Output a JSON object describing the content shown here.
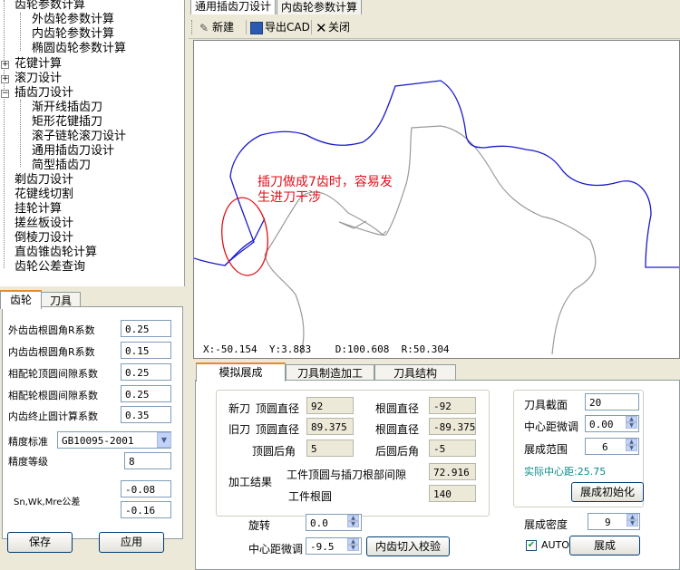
{
  "tree": {
    "items": [
      "齿轮参数计算",
      "外齿轮参数计算",
      "内齿轮参数计算",
      "椭圆齿轮参数计算",
      "花键计算",
      "滚刀设计",
      "插齿刀设计",
      "渐开线插齿刀",
      "矩形花键插刀",
      "滚子链轮滚刀设计",
      "通用插齿刀设计",
      "简型插齿刀",
      "剃齿刀设计",
      "花键线切割",
      "挂轮计算",
      "搓丝板设计",
      "倒棱刀设计",
      "直齿锥齿轮计算",
      "齿轮公差查询"
    ]
  },
  "left_panel": {
    "tabs": [
      "齿轮",
      "刀具"
    ],
    "fields": [
      {
        "label": "外齿齿根圆角R系数",
        "value": "0.25"
      },
      {
        "label": "内齿齿根圆角R系数",
        "value": "0.15"
      },
      {
        "label": "相配轮顶圆间隙系数",
        "value": "0.25"
      },
      {
        "label": "相配轮根圆间隙系数",
        "value": "0.25"
      },
      {
        "label": "内齿终止圆计算系数",
        "value": "0.35"
      }
    ],
    "standard_label": "精度标准",
    "standard_value": "GB10095-2001",
    "grade_label": "精度等级",
    "grade_value": "8",
    "tolerance_label": "Sn,Wk,Mre公差",
    "tolerance_values": [
      "-0.08",
      "-0.16"
    ],
    "save_label": "保存",
    "apply_label": "应用"
  },
  "right": {
    "tabs": [
      "通用插齿刀设计",
      "内齿轮参数计算"
    ],
    "toolbar": {
      "new_label": "新建",
      "export_label": "导出CAD",
      "close_label": "关闭"
    },
    "annotation": [
      "插刀做成7齿时，容易发",
      "生进刀干涉"
    ],
    "status": {
      "x": "X:-50.154",
      "y": "Y:3.883",
      "d": "D:100.608",
      "r": "R:50.304"
    },
    "colors": {
      "new_gear": "#1a1acd",
      "old_gear": "#9a9a9a",
      "annotation": "#e0101a"
    }
  },
  "bottom": {
    "tabs": [
      "模拟展成",
      "刀具制造加工",
      "刀具结构"
    ],
    "new_knife_label": "新刀",
    "old_knife_label": "旧刀",
    "tip_dia_label": "顶圆直径",
    "root_dia_label": "根圆直径",
    "new_tip": "92",
    "new_root": "-92",
    "old_tip": "89.375",
    "old_root": "-89.375",
    "back_angle_label": "顶圆后角",
    "back_angle_value": "5",
    "root_back_label": "后圆后角",
    "root_back_value": "-5",
    "result_label": "加工结果",
    "gap_label": "工件顶圆与插刀根部间隙",
    "gap_value": "72.916",
    "work_root_label": "工件根圆",
    "work_root_value": "140",
    "rotate_label": "旋转",
    "rotate_value": "0.0",
    "center_adj_label": "中心距微调",
    "center_adj_value": "-9.5",
    "check_btn": "内齿切入校验",
    "knife_section_label": "刀具截面",
    "knife_section_value": "20",
    "center_fine_label": "中心距微调",
    "center_fine_value": "0.00",
    "range_label": "展成范围",
    "range_value": "6",
    "actual_center": "实际中心距:25.75",
    "init_btn": "展成初始化",
    "density_label": "展成密度",
    "density_value": "9",
    "auto_label": "AUTO",
    "generate_btn": "展成"
  }
}
